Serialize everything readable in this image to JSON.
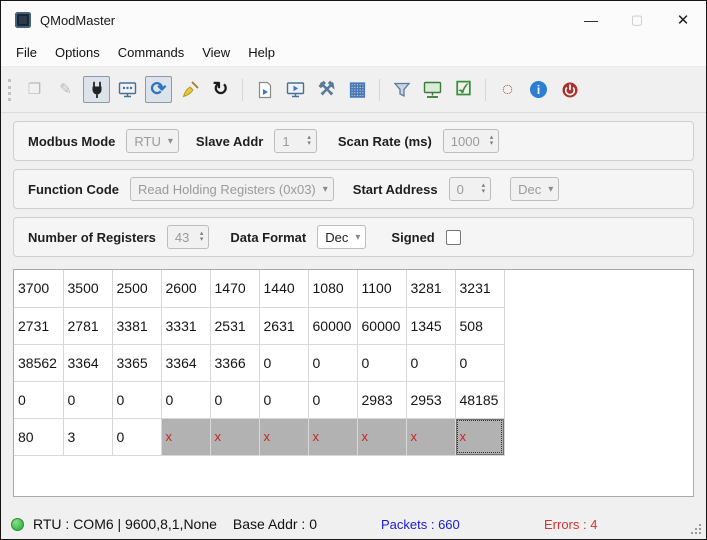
{
  "window": {
    "title": "QModMaster",
    "controls": {
      "minimize": "—",
      "maximize": "▢",
      "close": "✕"
    }
  },
  "menu": {
    "items": [
      "File",
      "Options",
      "Commands",
      "View",
      "Help"
    ]
  },
  "toolbar": {
    "items": [
      {
        "name": "load-session-icon",
        "kind": "glyph",
        "glyph": "❐",
        "color": "#b9b9b9",
        "disabled": true
      },
      {
        "name": "save-session-icon",
        "kind": "glyph",
        "glyph": "✎",
        "color": "#b9b9b9",
        "disabled": true
      },
      {
        "name": "connect-icon",
        "kind": "svg",
        "svg": "plug",
        "pressed": true
      },
      {
        "name": "modbus-scan-icon",
        "kind": "svg",
        "svg": "monitor-scan"
      },
      {
        "name": "scan-loop-icon",
        "kind": "glyph",
        "glyph": "⟳",
        "color": "#2e74c0",
        "big": true,
        "pressed": true
      },
      {
        "name": "clear-icon",
        "kind": "svg",
        "svg": "broom"
      },
      {
        "name": "reset-counters-icon",
        "kind": "glyph",
        "glyph": "↻",
        "color": "#1c1c1c",
        "big": true
      },
      {
        "separator": true
      },
      {
        "name": "log-icon",
        "kind": "svg",
        "svg": "doc-play"
      },
      {
        "name": "bus-monitor-icon",
        "kind": "svg",
        "svg": "monitor-play"
      },
      {
        "name": "tools-icon",
        "kind": "glyph",
        "glyph": "⚒",
        "color": "#5a7a9a",
        "big": true
      },
      {
        "name": "registers-table-icon",
        "kind": "glyph",
        "glyph": "▦",
        "color": "#4a7ab5",
        "big": true
      },
      {
        "separator": true
      },
      {
        "name": "filter-icon",
        "kind": "svg",
        "svg": "funnel"
      },
      {
        "name": "serial-settings-icon",
        "kind": "svg",
        "svg": "monitor-net"
      },
      {
        "name": "options-check-icon",
        "kind": "glyph",
        "glyph": "☑",
        "color": "#3a8f3a",
        "big": true
      },
      {
        "separator": true
      },
      {
        "name": "busy-indicator-icon",
        "kind": "glyph",
        "glyph": "◌",
        "color": "#b03030",
        "big": true
      },
      {
        "name": "info-icon",
        "kind": "badge",
        "letter": "i",
        "bg": "#2a7fd4"
      },
      {
        "name": "exit-icon",
        "kind": "svg",
        "svg": "power"
      }
    ]
  },
  "settings": {
    "modbus_mode": {
      "label": "Modbus Mode",
      "value": "RTU",
      "disabled": true
    },
    "slave_addr": {
      "label": "Slave Addr",
      "value": "1",
      "disabled": true
    },
    "scan_rate": {
      "label": "Scan Rate (ms)",
      "value": "1000",
      "disabled": true
    },
    "function_code": {
      "label": "Function Code",
      "value": "Read Holding Registers (0x03)",
      "disabled": true
    },
    "start_address": {
      "label": "Start Address",
      "value": "0",
      "disabled": true
    },
    "start_address_base": {
      "value": "Dec",
      "disabled": true
    },
    "number_of_registers": {
      "label": "Number of Registers",
      "value": "43",
      "disabled": true
    },
    "data_format": {
      "label": "Data Format",
      "value": "Dec",
      "disabled": false
    },
    "signed": {
      "label": "Signed",
      "checked": false
    }
  },
  "table": {
    "rows": [
      [
        "3700",
        "3500",
        "2500",
        "2600",
        "1470",
        "1440",
        "1080",
        "1100",
        "3281",
        "3231"
      ],
      [
        "2731",
        "2781",
        "3381",
        "3331",
        "2531",
        "2631",
        "60000",
        "60000",
        "1345",
        "508"
      ],
      [
        "38562",
        "3364",
        "3365",
        "3364",
        "3366",
        "0",
        "0",
        "0",
        "0",
        "0"
      ],
      [
        "0",
        "0",
        "0",
        "0",
        "0",
        "0",
        "0",
        "2983",
        "2953",
        "48185"
      ],
      [
        "80",
        "3",
        "0",
        "x",
        "x",
        "x",
        "x",
        "x",
        "x",
        "x"
      ]
    ],
    "invalid_marker": "x",
    "selected_cell": {
      "row": 4,
      "col": 9
    }
  },
  "statusbar": {
    "connection": "RTU : COM6 | 9600,8,1,None",
    "base_addr": "Base Addr : 0",
    "packets": "Packets : 660",
    "errors": "Errors : 4"
  },
  "colors": {
    "packets_text": "#1a1ad4",
    "errors_text": "#d83232",
    "status_ok": "#3cb94c",
    "invalid_cell_bg": "#b2b2b2",
    "invalid_cell_text": "#cc2222"
  }
}
